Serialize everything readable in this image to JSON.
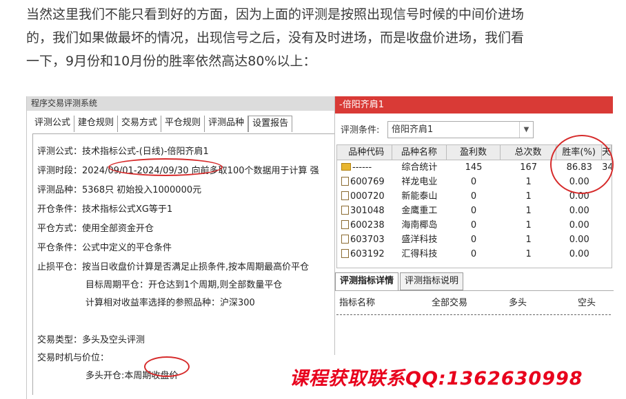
{
  "article": {
    "line1": "当然这里我们不能只看到好的方面，因为上面的评测是按照出现信号时候的中间价进场",
    "line2": "的，我们如果做最坏的情况，出现信号之后，没有及时进场，而是收盘价进场，我们看",
    "line3": "一下，9月份和10月份的胜率依然高达80%以上："
  },
  "left_window": {
    "title": "程序交易评测系统",
    "tabs": [
      "评测公式",
      "建仓规则",
      "交易方式",
      "平仓规则",
      "评测品种",
      "设置报告"
    ],
    "rows": [
      "评测公式：技术指标公式-(日线)-倍阳齐肩1",
      "评测时段：2024/09/01-2024/09/30 向前多取100个数据用于计算 强",
      "评测品种：5368只 初始投入1000000元",
      "开仓条件：技术指标公式XG等于1",
      "平仓方式：使用全部资金开仓",
      "平仓条件：公式中定义的平仓条件",
      "止损平仓：按当日收盘价计算是否满足止损条件,按本周期最高价平仓",
      "目标周期平仓：开仓达到1个周期,则全部数量平仓",
      "计算相对收益率选择的参照品种：沪深300",
      "交易类型：多头及空头评测",
      "交易时机与价位：",
      "多头开仓:本周期收盘价"
    ]
  },
  "right_window": {
    "title": "-倍阳齐肩1",
    "condition_label": "评测条件:",
    "condition_value": "倍阳齐肩1",
    "columns": [
      "品种代码",
      "品种名称",
      "盈利数",
      "总次数",
      "胜率(%)",
      "天"
    ],
    "rows": [
      {
        "code": "------",
        "name": "综合统计",
        "win": "145",
        "total": "167",
        "rate": "86.83",
        "extra": "34"
      },
      {
        "code": "600769",
        "name": "祥龙电业",
        "win": "0",
        "total": "1",
        "rate": "0.00",
        "extra": ""
      },
      {
        "code": "000720",
        "name": "新能泰山",
        "win": "0",
        "total": "1",
        "rate": "0.00",
        "extra": ""
      },
      {
        "code": "301048",
        "name": "金鹰重工",
        "win": "0",
        "total": "1",
        "rate": "0.00",
        "extra": ""
      },
      {
        "code": "600238",
        "name": "海南椰岛",
        "win": "0",
        "total": "1",
        "rate": "0.00",
        "extra": ""
      },
      {
        "code": "603703",
        "name": "盛洋科技",
        "win": "0",
        "total": "1",
        "rate": "0.00",
        "extra": ""
      },
      {
        "code": "603192",
        "name": "汇得科技",
        "win": "0",
        "total": "1",
        "rate": "0.00",
        "extra": ""
      }
    ],
    "bottom_tabs": [
      "评测指标详情",
      "评测指标说明"
    ],
    "bottom_columns": [
      "指标名称",
      "全部交易",
      "多头",
      "空头"
    ]
  },
  "watermark": "课程获取联系QQ:1362630998",
  "colors": {
    "accent_red": "#d93a36",
    "annotation": "#d62a2a",
    "watermark": "#e8001c"
  }
}
